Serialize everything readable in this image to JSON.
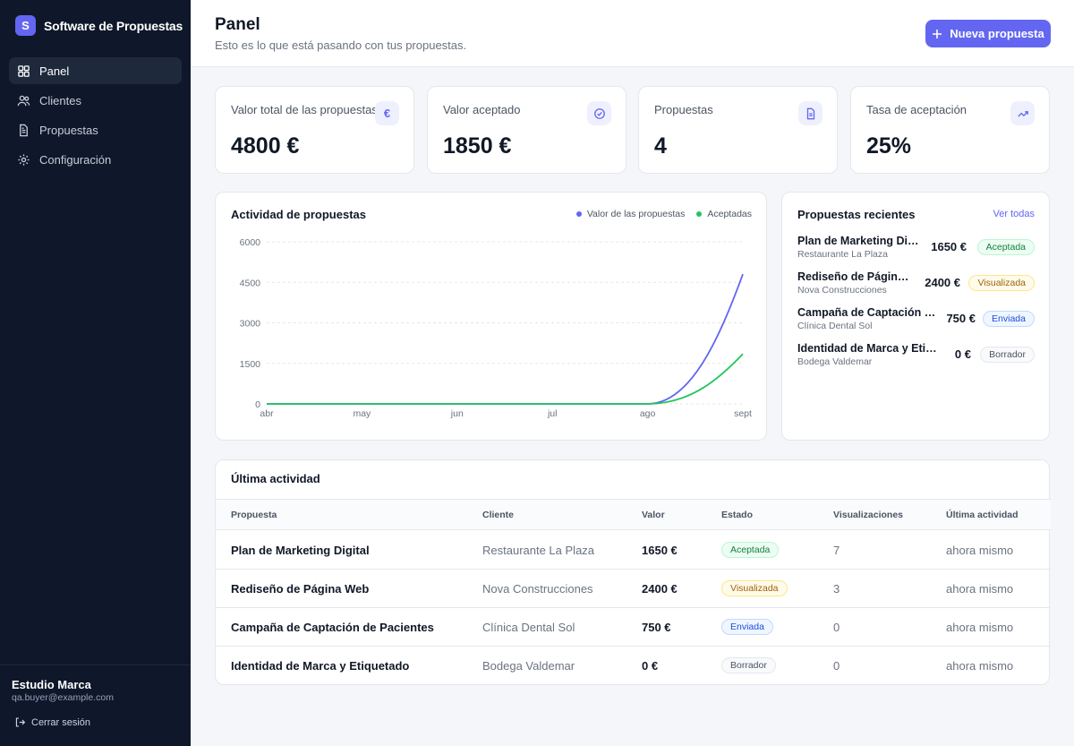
{
  "app": {
    "logo_letter": "S",
    "name": "Software de Propuestas"
  },
  "sidebar": {
    "items": [
      {
        "label": "Panel",
        "icon": "grid-icon",
        "active": true
      },
      {
        "label": "Clientes",
        "icon": "users-icon",
        "active": false
      },
      {
        "label": "Propuestas",
        "icon": "document-icon",
        "active": false
      },
      {
        "label": "Configuración",
        "icon": "gear-icon",
        "active": false
      }
    ],
    "user": {
      "name": "Estudio Marca",
      "email": "qa.buyer@example.com"
    },
    "logout_label": "Cerrar sesión"
  },
  "header": {
    "title": "Panel",
    "subtitle": "Esto es lo que está pasando con tus propuestas.",
    "new_button_label": "Nueva propuesta"
  },
  "stats": [
    {
      "label": "Valor total de las propuestas",
      "value": "4800 €",
      "icon": "euro-icon"
    },
    {
      "label": "Valor aceptado",
      "value": "1850 €",
      "icon": "check-circle-icon"
    },
    {
      "label": "Propuestas",
      "value": "4",
      "icon": "document-icon"
    },
    {
      "label": "Tasa de aceptación",
      "value": "25%",
      "icon": "trending-up-icon"
    }
  ],
  "colors": {
    "accent": "#6366f1",
    "success": "#22c55e",
    "sidebar_bg": "#0f172a"
  },
  "activity_chart": {
    "title": "Actividad de propuestas",
    "legend": [
      {
        "label": "Valor de las propuestas",
        "color": "#6366f1"
      },
      {
        "label": "Aceptadas",
        "color": "#22c55e"
      }
    ]
  },
  "chart_data": {
    "type": "line",
    "x": [
      "abr",
      "may",
      "jun",
      "jul",
      "ago",
      "sept"
    ],
    "series": [
      {
        "name": "Valor de las propuestas",
        "values": [
          0,
          0,
          0,
          0,
          0,
          4800
        ]
      },
      {
        "name": "Aceptadas",
        "values": [
          0,
          0,
          0,
          0,
          0,
          1850
        ]
      }
    ],
    "yticks": [
      "0",
      "1500",
      "3000",
      "4500",
      "6000"
    ],
    "ylim": [
      0,
      6000
    ],
    "grid": true,
    "legend_position": "top-right"
  },
  "recent": {
    "title": "Propuestas recientes",
    "see_all_label": "Ver todas",
    "items": [
      {
        "title": "Plan de Marketing Digital",
        "client": "Restaurante La Plaza",
        "value": "1650 €",
        "status": "Aceptada",
        "status_key": "aceptada"
      },
      {
        "title": "Rediseño de Página Web",
        "client": "Nova Construcciones",
        "value": "2400 €",
        "status": "Visualizada",
        "status_key": "visualizada"
      },
      {
        "title": "Campaña de Captación de Pacientes",
        "client": "Clínica Dental Sol",
        "value": "750 €",
        "status": "Enviada",
        "status_key": "enviada"
      },
      {
        "title": "Identidad de Marca y Etiquetado",
        "client": "Bodega Valdemar",
        "value": "0 €",
        "status": "Borrador",
        "status_key": "borrador"
      }
    ]
  },
  "activity_table": {
    "title": "Última actividad",
    "columns": [
      "Propuesta",
      "Cliente",
      "Valor",
      "Estado",
      "Visualizaciones",
      "Última actividad"
    ],
    "rows": [
      {
        "proposal": "Plan de Marketing Digital",
        "client": "Restaurante La Plaza",
        "value": "1650 €",
        "status": "Aceptada",
        "status_key": "aceptada",
        "views": "7",
        "last": "ahora mismo"
      },
      {
        "proposal": "Rediseño de Página Web",
        "client": "Nova Construcciones",
        "value": "2400 €",
        "status": "Visualizada",
        "status_key": "visualizada",
        "views": "3",
        "last": "ahora mismo"
      },
      {
        "proposal": "Campaña de Captación de Pacientes",
        "client": "Clínica Dental Sol",
        "value": "750 €",
        "status": "Enviada",
        "status_key": "enviada",
        "views": "0",
        "last": "ahora mismo"
      },
      {
        "proposal": "Identidad de Marca y Etiquetado",
        "client": "Bodega Valdemar",
        "value": "0 €",
        "status": "Borrador",
        "status_key": "borrador",
        "views": "0",
        "last": "ahora mismo"
      }
    ]
  }
}
